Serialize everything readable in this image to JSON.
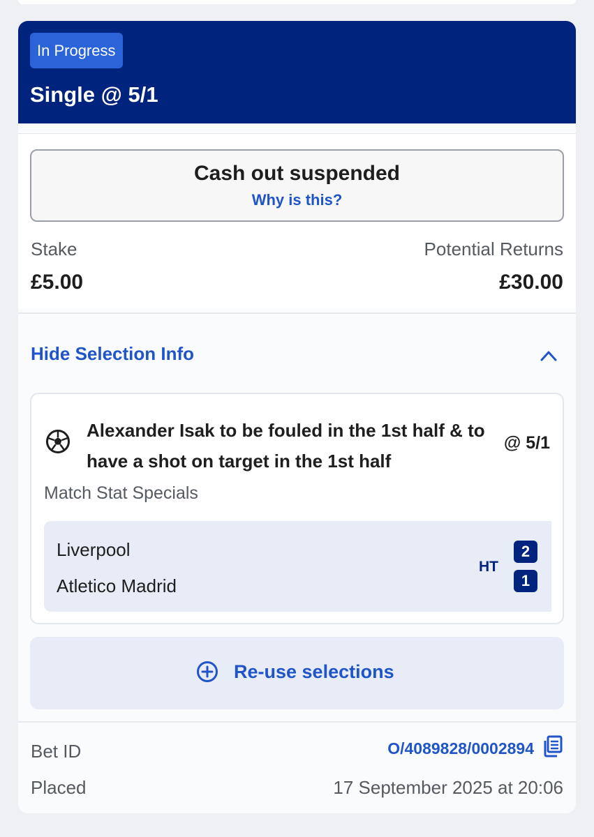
{
  "bet": {
    "status": "In Progress",
    "type": "Single @ 5/1"
  },
  "cashout": {
    "title": "Cash out suspended",
    "link": "Why is this?"
  },
  "stake": {
    "label": "Stake",
    "value": "£5.00"
  },
  "returns": {
    "label": "Potential Returns",
    "value": "£30.00"
  },
  "selection_toggle": {
    "label": "Hide Selection Info",
    "icon": "chevron-up-icon"
  },
  "selection": {
    "icon": "football-icon",
    "name": "Alexander Isak to be fouled in the 1st half & to have a shot on target in the 1st half",
    "odds": "@ 5/1",
    "market": "Match Stat Specials",
    "home_team": "Liverpool",
    "away_team": "Atletico Madrid",
    "period": "HT",
    "home_score": "2",
    "away_score": "1"
  },
  "reuse": {
    "label": "Re-use selections",
    "icon": "plus-circle-icon"
  },
  "bet_id": {
    "label": "Bet ID",
    "value": "O/4089828/0002894",
    "icon": "copy-icon"
  },
  "placed": {
    "label": "Placed",
    "value": "17 September 2025 at 20:06"
  },
  "colors": {
    "header_bg": "#00237d",
    "badge_bg": "#2b63d9",
    "link": "#2055c8",
    "panel_bg": "#e8ecf6"
  }
}
